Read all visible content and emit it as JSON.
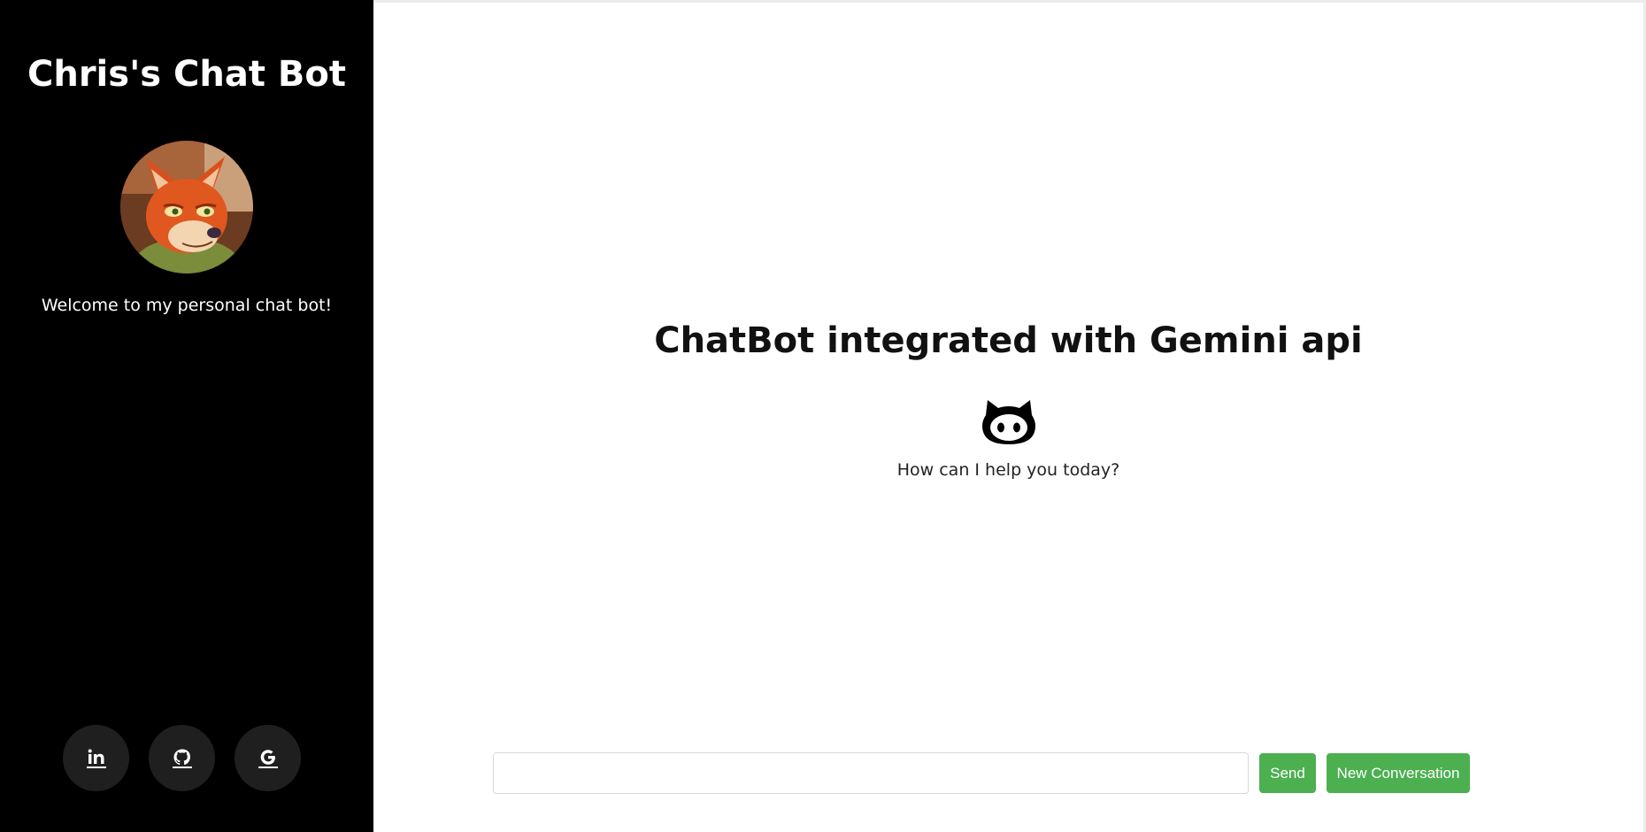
{
  "sidebar": {
    "title": "Chris's Chat Bot",
    "welcome": "Welcome to my personal chat bot!",
    "avatar_icon": "fox-avatar",
    "social": [
      {
        "icon": "linkedin-icon"
      },
      {
        "icon": "github-icon"
      },
      {
        "icon": "google-icon"
      }
    ]
  },
  "main": {
    "heading": "ChatBot integrated with Gemini api",
    "bot_icon": "github-octocat-icon",
    "prompt": "How can I help you today?"
  },
  "composer": {
    "input_value": "",
    "input_placeholder": "",
    "send_label": "Send",
    "new_conversation_label": "New Conversation"
  },
  "colors": {
    "sidebar_bg": "#000000",
    "social_btn_bg": "#1f1f1f",
    "accent_green": "#4caf50"
  }
}
